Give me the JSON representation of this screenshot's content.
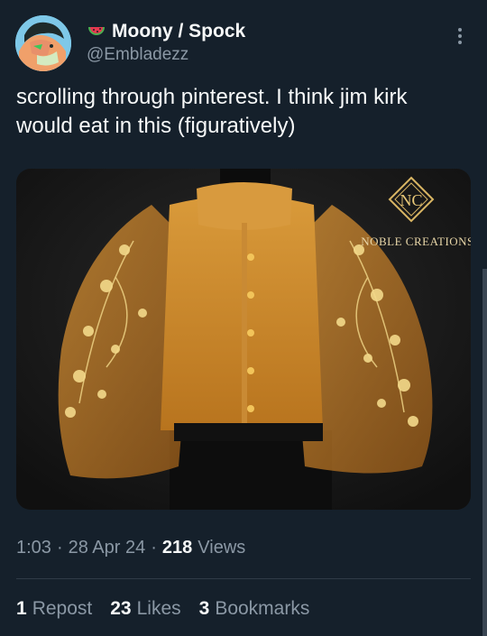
{
  "author": {
    "display_name": "Moony / Spock",
    "handle": "@Embladezz",
    "name_emoji_icon": "watermelon-icon"
  },
  "tweet": {
    "text": "scrolling through pinterest. I think jim kirk would eat in this (figuratively)"
  },
  "media": {
    "description_icon": "garment-photo",
    "watermark_text": "NOBLE CREATIONS",
    "watermark_monogram": "NC"
  },
  "meta": {
    "time": "1:03",
    "date": "28 Apr 24",
    "views_count": "218",
    "views_label": "Views",
    "separator": "·"
  },
  "stats": {
    "reposts_count": "1",
    "reposts_label": "Repost",
    "likes_count": "23",
    "likes_label": "Likes",
    "bookmarks_count": "3",
    "bookmarks_label": "Bookmarks"
  },
  "colors": {
    "background": "#15202b",
    "text_primary": "#f7f9f9",
    "text_secondary": "#8b98a5",
    "divider": "#2f3b47"
  }
}
